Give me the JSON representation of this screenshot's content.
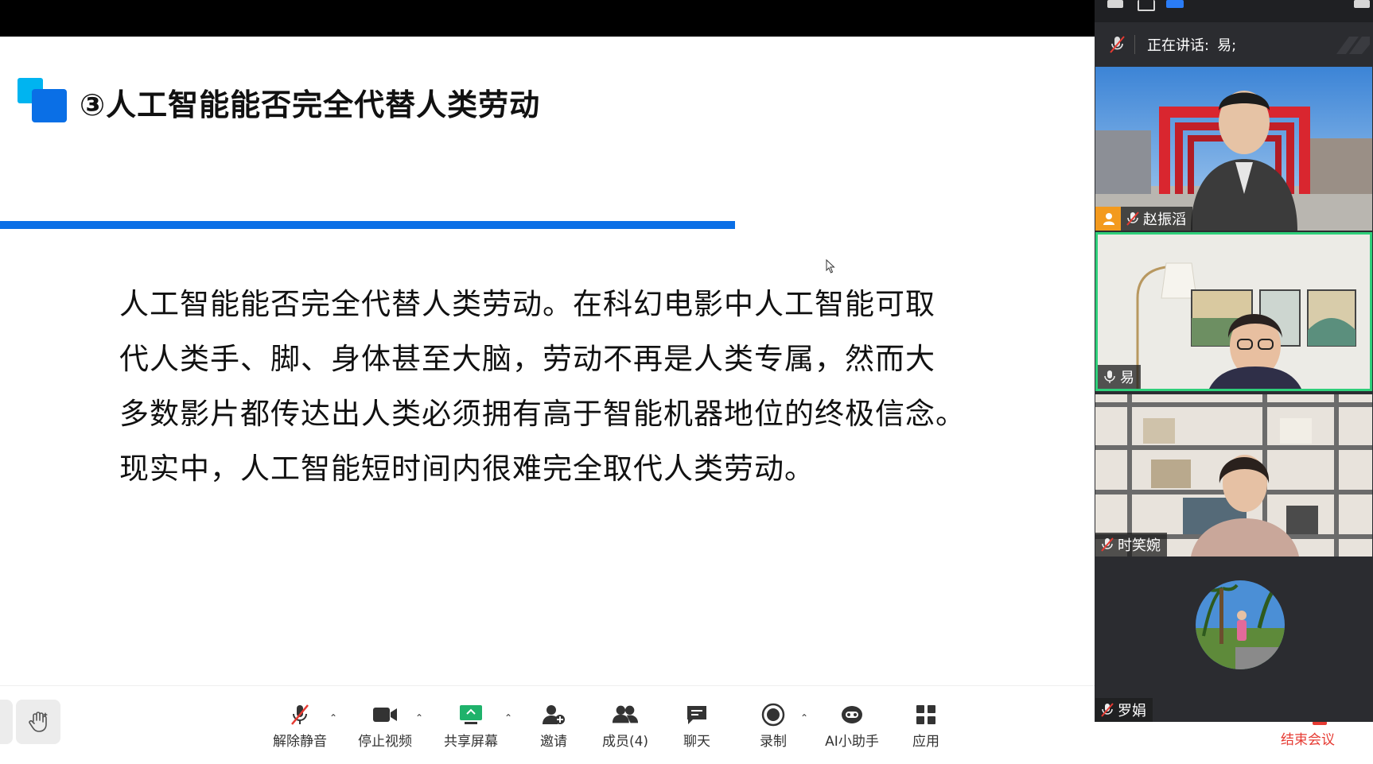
{
  "slide": {
    "title": "③人工智能能否完全代替人类劳动",
    "body_lines": [
      "人工智能能否完全代替人类劳动。在科幻电影中人工智能可取",
      "代人类手、脚、身体甚至大脑，劳动不再是人类专属，然而大",
      "多数影片都传达出人类必须拥有高于智能机器地位的终极信念。",
      "现实中，人工智能短时间内很难完全取代人类劳动。"
    ],
    "accent_color": "#0a6fe6",
    "logo_colors": [
      "#00b4f0",
      "#0a6fe6"
    ]
  },
  "meeting_panel": {
    "speaking_label": "正在讲话:",
    "speaking_name": "易;",
    "participants": [
      {
        "name": "赵振滔",
        "mic": "muted",
        "badge": "host-person-icon"
      },
      {
        "name": "易",
        "mic": "on",
        "active_speaker": true
      },
      {
        "name": "时笑婉",
        "mic": "muted"
      },
      {
        "name": "罗娟",
        "mic": "muted",
        "avatar_only": true
      }
    ]
  },
  "toolbar": {
    "buttons": [
      {
        "label": "解除静音",
        "icon": "mic-muted-icon"
      },
      {
        "label": "停止视频",
        "icon": "video-camera-icon"
      },
      {
        "label": "共享屏幕",
        "icon": "share-screen-icon"
      },
      {
        "label": "邀请",
        "icon": "invite-user-icon"
      },
      {
        "label": "成员(4)",
        "icon": "members-icon"
      },
      {
        "label": "聊天",
        "icon": "chat-icon"
      },
      {
        "label": "录制",
        "icon": "record-icon"
      },
      {
        "label": "AI小助手",
        "icon": "ai-assistant-icon"
      },
      {
        "label": "应用",
        "icon": "apps-icon"
      }
    ],
    "end_meeting": "结束会议",
    "end_color": "#e63a32",
    "share_color": "#1fb26b"
  }
}
